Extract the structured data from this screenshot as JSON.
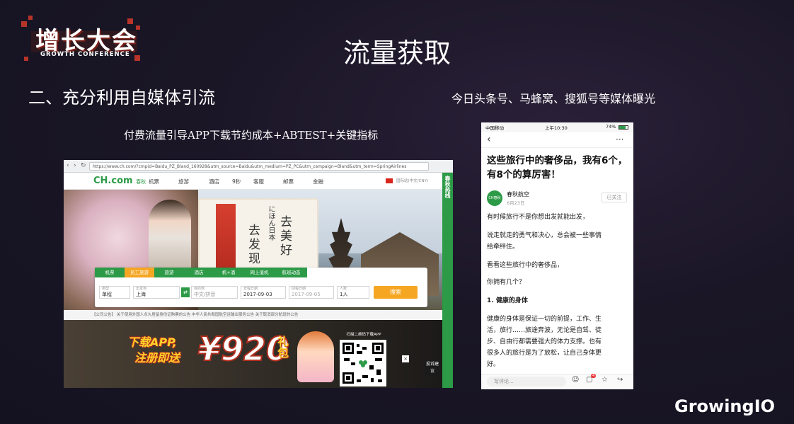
{
  "logo": {
    "title": "增长大会",
    "subtitle": "GROWTH CONFERENCE"
  },
  "slide": {
    "title": "流量获取",
    "section_heading": "二、充分利用自媒体引流",
    "media_caption": "今日头条号、马蜂窝、搜狐号等媒体曝光",
    "left_caption": "付费流量引导APP下载节约成本+ABTEST+关键指标"
  },
  "browser": {
    "url": "https://www.ch.com/?cmpid=Baidu_PZ_Bland_160928&utm_source=Baidu&utm_medium=PZ_PC&utm_campaign=Bland&utm_term=SpringAirlines",
    "brand": "CH.com",
    "brand_cn": "春秋",
    "nav": [
      "机票",
      "旅游",
      "酒店",
      "9秒",
      "客服",
      "邮票",
      "金融"
    ],
    "header_right": "国际站(中文/CNY)",
    "side_label": "春秋热线",
    "hero": {
      "text1": "去发现",
      "text2": "にほん日本",
      "text3": "去美好"
    },
    "search_tabs": [
      "机票",
      "员工旅游",
      "旅游",
      "酒店",
      "机+酒",
      "网上值机",
      "航班动态"
    ],
    "fields": [
      {
        "label": "类型",
        "value": "单程"
      },
      {
        "label": "出发地",
        "value": "上海"
      },
      {
        "label": "目的地",
        "value": "中文/拼音"
      },
      {
        "label": "去程日期",
        "value": "2017-09-03"
      },
      {
        "label": "回程日期",
        "value": "2017-09-05"
      },
      {
        "label": "人数",
        "value": "1人"
      }
    ],
    "search_button": "搜索",
    "notice": "【公司公告】  关于使用外国人永久居留身份证购票的公告   中华人民共和国航空运输业服务公告   关于取消部分航班的公告",
    "banner": {
      "download": "下载APP,",
      "register": "注册即送",
      "amount": "¥920",
      "gift": "礼包",
      "qr_label": "扫描二维码下载APP",
      "complaint": "投诉建议",
      "close": "×"
    }
  },
  "phone": {
    "status_left": "中国移动",
    "status_time": "上午10:30",
    "status_right": "74%",
    "back": "‹",
    "more": "···",
    "title": "这些旅行中的奢侈品，我有6个，有8个的算厉害！",
    "avatar": "CH春秋",
    "author": "春秋航空",
    "date": "6月23日",
    "follow": "已关注",
    "paragraphs": [
      "有时候旅行不是你想出发就能出发，",
      "说走就走的勇气和决心，总会被一些事情",
      "给牵绊住。",
      "看看这些旅行中的奢侈品，",
      "你拥有几个？",
      "1. 健康的身体",
      "健康的身体是保证一切的前提，工作、生",
      "活，旅行……旅途奔波，无论是自驾、徒",
      "步、自由行都需要强大的体力支撑。也有",
      "很多人的旅行是为了放松，让自己身体更",
      "好。"
    ],
    "comment_placeholder": "写评论...",
    "badge": "4"
  },
  "footer_brand": "GrowingIO"
}
